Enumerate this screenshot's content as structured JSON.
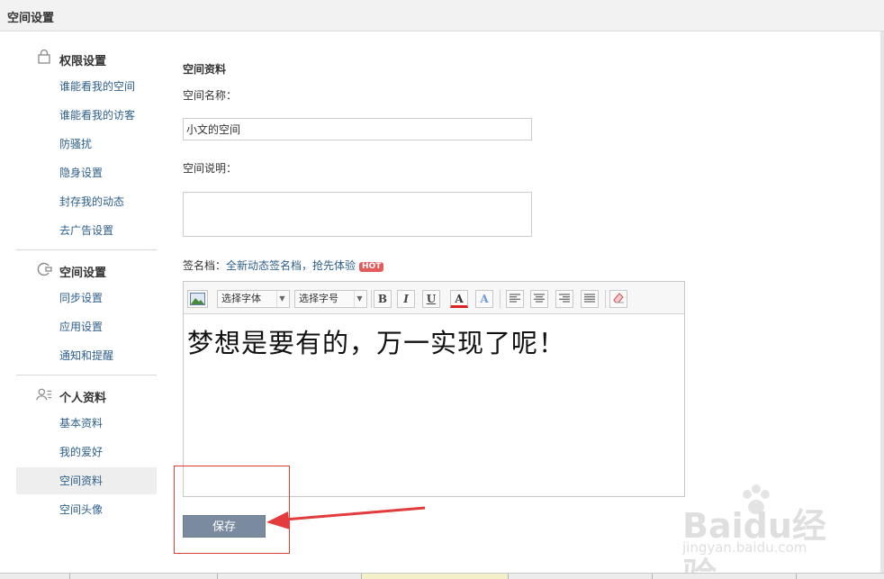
{
  "header": {
    "title": "空间设置"
  },
  "sidebar": {
    "sections": [
      {
        "title": "权限设置",
        "icon": "lock-icon",
        "items": [
          "谁能看我的空间",
          "谁能看我的访客",
          "防骚扰",
          "隐身设置",
          "封存我的动态",
          "去广告设置"
        ]
      },
      {
        "title": "空间设置",
        "icon": "space-settings-icon",
        "items": [
          "同步设置",
          "应用设置",
          "通知和提醒"
        ]
      },
      {
        "title": "个人资料",
        "icon": "person-icon",
        "items": [
          "基本资料",
          "我的爱好",
          "空间资料",
          "空间头像"
        ]
      }
    ],
    "active_item": "空间资料"
  },
  "main": {
    "section_title": "空间资料",
    "name_label": "空间名称：",
    "name_value": "小文的空间",
    "desc_label": "空间说明：",
    "desc_value": "",
    "signature_label": "签名档：",
    "signature_link": "全新动态签名档，抢先体验",
    "hot_badge": "HOT",
    "editor": {
      "font_select": "选择字体",
      "size_select": "选择字号",
      "content": "梦想是要有的，万一实现了呢！"
    },
    "save_label": "保存"
  },
  "watermark": {
    "brand": "Baidu经验",
    "url": "jingyan.baidu.com"
  },
  "colors": {
    "link": "#2d5f8b",
    "save_button": "#7a8ba0",
    "highlight": "#e23c3c",
    "hot": "#e35b5b"
  }
}
